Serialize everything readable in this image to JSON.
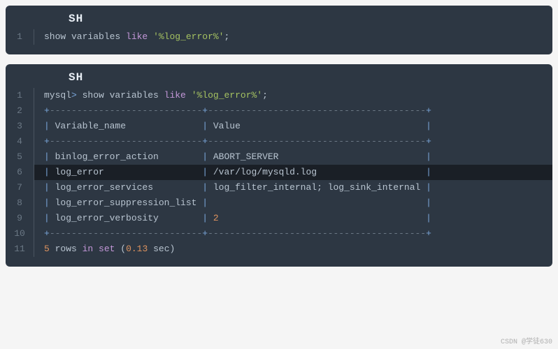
{
  "block1": {
    "lang": "SH",
    "lines": [
      {
        "n": "1",
        "seg": [
          {
            "c": "t-text",
            "t": "show variables "
          },
          {
            "c": "t-keyword",
            "t": "like"
          },
          {
            "c": "t-text",
            "t": " "
          },
          {
            "c": "t-string",
            "t": "'%log_error%'"
          },
          {
            "c": "t-punct",
            "t": ";"
          }
        ]
      }
    ]
  },
  "block2": {
    "lang": "SH",
    "lines": [
      {
        "n": "1",
        "seg": [
          {
            "c": "t-prompt",
            "t": "mysql"
          },
          {
            "c": "t-op",
            "t": ">"
          },
          {
            "c": "t-text",
            "t": " show variables "
          },
          {
            "c": "t-keyword",
            "t": "like"
          },
          {
            "c": "t-text",
            "t": " "
          },
          {
            "c": "t-string",
            "t": "'%log_error%'"
          },
          {
            "c": "t-punct",
            "t": ";"
          }
        ]
      },
      {
        "n": "2",
        "seg": [
          {
            "c": "t-op",
            "t": "+"
          },
          {
            "c": "t-border",
            "t": "----------------------------"
          },
          {
            "c": "t-op",
            "t": "+"
          },
          {
            "c": "t-border",
            "t": "----------------------------------------"
          },
          {
            "c": "t-op",
            "t": "+"
          }
        ]
      },
      {
        "n": "3",
        "seg": [
          {
            "c": "t-op",
            "t": "|"
          },
          {
            "c": "t-text",
            "t": " Variable_name              "
          },
          {
            "c": "t-op",
            "t": "|"
          },
          {
            "c": "t-text",
            "t": " Value                                  "
          },
          {
            "c": "t-op",
            "t": "|"
          }
        ]
      },
      {
        "n": "4",
        "seg": [
          {
            "c": "t-op",
            "t": "+"
          },
          {
            "c": "t-border",
            "t": "----------------------------"
          },
          {
            "c": "t-op",
            "t": "+"
          },
          {
            "c": "t-border",
            "t": "----------------------------------------"
          },
          {
            "c": "t-op",
            "t": "+"
          }
        ]
      },
      {
        "n": "5",
        "seg": [
          {
            "c": "t-op",
            "t": "|"
          },
          {
            "c": "t-text",
            "t": " binlog_error_action        "
          },
          {
            "c": "t-op",
            "t": "|"
          },
          {
            "c": "t-text",
            "t": " ABORT_SERVER                           "
          },
          {
            "c": "t-op",
            "t": "|"
          }
        ]
      },
      {
        "n": "6",
        "hl": true,
        "seg": [
          {
            "c": "t-op",
            "t": "|"
          },
          {
            "c": "t-text",
            "t": " log_error                  "
          },
          {
            "c": "t-op",
            "t": "|"
          },
          {
            "c": "t-text",
            "t": " /var/log/mysqld.log                    "
          },
          {
            "c": "t-op",
            "t": "|"
          }
        ]
      },
      {
        "n": "7",
        "seg": [
          {
            "c": "t-op",
            "t": "|"
          },
          {
            "c": "t-text",
            "t": " log_error_services         "
          },
          {
            "c": "t-op",
            "t": "|"
          },
          {
            "c": "t-text",
            "t": " log_filter_internal; log_sink_internal "
          },
          {
            "c": "t-op",
            "t": "|"
          }
        ]
      },
      {
        "n": "8",
        "seg": [
          {
            "c": "t-op",
            "t": "|"
          },
          {
            "c": "t-text",
            "t": " log_error_suppression_list "
          },
          {
            "c": "t-op",
            "t": "|"
          },
          {
            "c": "t-text",
            "t": "                                        "
          },
          {
            "c": "t-op",
            "t": "|"
          }
        ]
      },
      {
        "n": "9",
        "seg": [
          {
            "c": "t-op",
            "t": "|"
          },
          {
            "c": "t-text",
            "t": " log_error_verbosity        "
          },
          {
            "c": "t-op",
            "t": "|"
          },
          {
            "c": "t-text",
            "t": " "
          },
          {
            "c": "t-num",
            "t": "2"
          },
          {
            "c": "t-text",
            "t": "                                      "
          },
          {
            "c": "t-op",
            "t": "|"
          }
        ]
      },
      {
        "n": "10",
        "seg": [
          {
            "c": "t-op",
            "t": "+"
          },
          {
            "c": "t-border",
            "t": "----------------------------"
          },
          {
            "c": "t-op",
            "t": "+"
          },
          {
            "c": "t-border",
            "t": "----------------------------------------"
          },
          {
            "c": "t-op",
            "t": "+"
          }
        ]
      },
      {
        "n": "11",
        "seg": [
          {
            "c": "t-num",
            "t": "5"
          },
          {
            "c": "t-text",
            "t": " rows "
          },
          {
            "c": "t-keyword",
            "t": "in"
          },
          {
            "c": "t-text",
            "t": " "
          },
          {
            "c": "t-keyword",
            "t": "set"
          },
          {
            "c": "t-text",
            "t": " "
          },
          {
            "c": "t-punct",
            "t": "("
          },
          {
            "c": "t-num",
            "t": "0.13"
          },
          {
            "c": "t-text",
            "t": " sec"
          },
          {
            "c": "t-punct",
            "t": ")"
          }
        ]
      }
    ]
  },
  "watermark": "CSDN @学徒630"
}
